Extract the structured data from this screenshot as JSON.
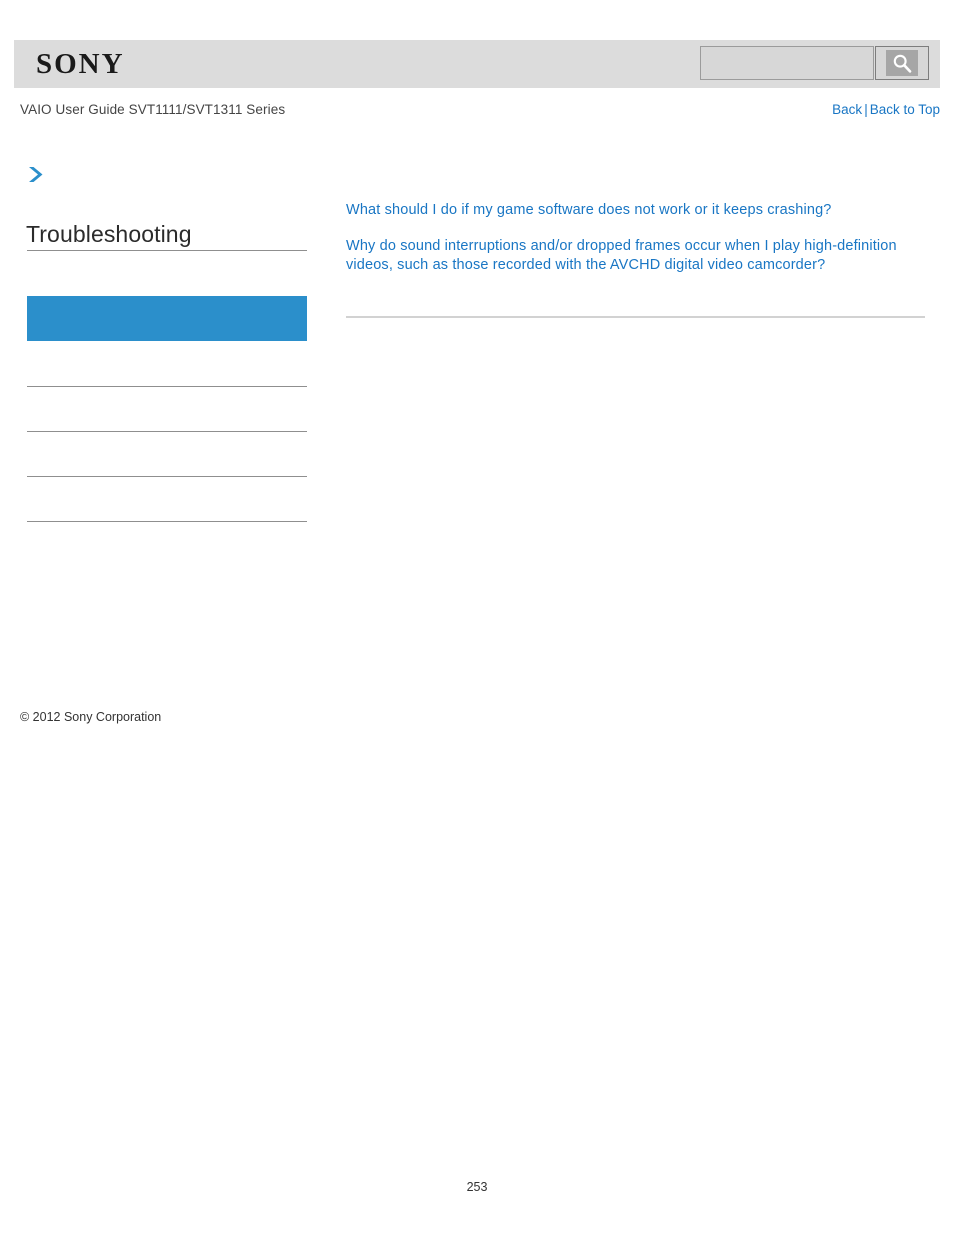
{
  "header": {
    "logo_text": "SONY",
    "search": {
      "value": "",
      "placeholder": "",
      "icon": "search-icon",
      "button_label": ""
    }
  },
  "subheader": {
    "guide_title": "VAIO User Guide SVT1111/SVT1311 Series",
    "back_label": "Back",
    "separator": "|",
    "back_to_top_label": "Back to Top"
  },
  "sidebar": {
    "nav_arrow_icon": "chevron-right-icon",
    "section_title": "Troubleshooting",
    "items": [
      {
        "label": "",
        "active": true
      },
      {
        "label": "",
        "active": false
      },
      {
        "label": "",
        "active": false
      },
      {
        "label": "",
        "active": false
      },
      {
        "label": "",
        "active": false
      }
    ],
    "copyright": "© 2012 Sony Corporation"
  },
  "content": {
    "links": [
      "What should I do if my game software does not work or it keeps crashing?",
      "Why do sound interruptions and/or dropped frames occur when I play high-definition videos, such as those recorded with the AVCHD digital video camcorder?"
    ]
  },
  "footer": {
    "page_number": "253"
  },
  "colors": {
    "accent_blue": "#1976c4",
    "active_nav_blue": "#2b8fcb",
    "header_gray": "#dcdcdc",
    "rule_gray": "#8f8f8f"
  }
}
